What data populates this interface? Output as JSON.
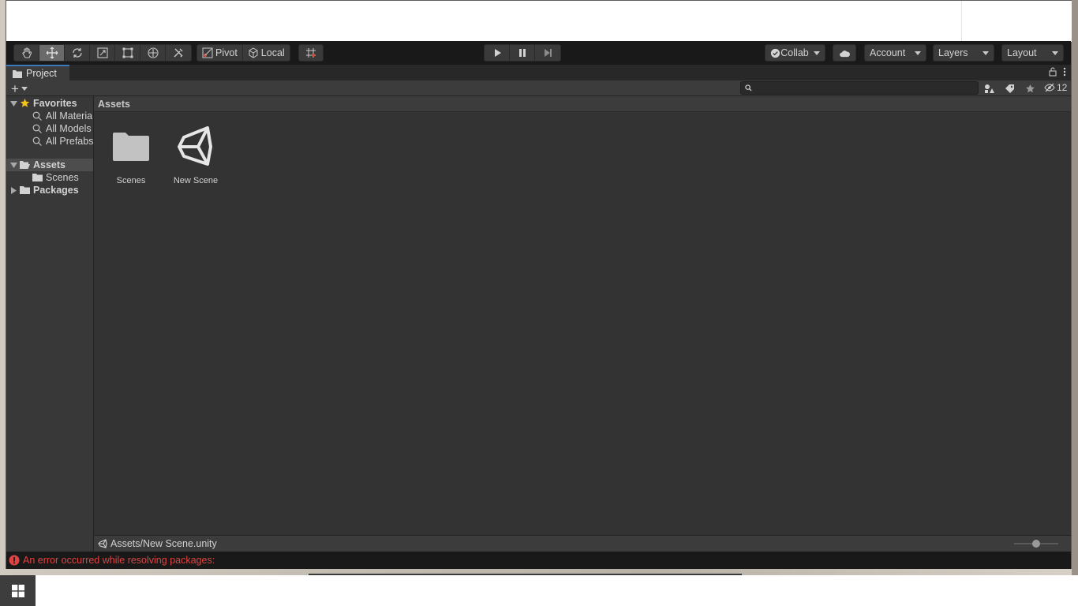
{
  "toolbar": {
    "tools": [
      "hand-tool",
      "move-tool",
      "rotate-tool",
      "scale-tool",
      "rect-tool",
      "transform-tool",
      "custom-tool"
    ],
    "pivot_label": "Pivot",
    "local_label": "Local",
    "collab_label": "Collab",
    "account_label": "Account",
    "layers_label": "Layers",
    "layout_label": "Layout"
  },
  "project": {
    "tab_label": "Project",
    "search_placeholder": "",
    "hidden_count": "12"
  },
  "tree": {
    "favorites_label": "Favorites",
    "favorites": [
      "All Materia",
      "All Models",
      "All Prefabs"
    ],
    "assets_label": "Assets",
    "assets_children": [
      "Scenes"
    ],
    "packages_label": "Packages"
  },
  "main": {
    "breadcrumb": "Assets",
    "items": [
      {
        "label": "Scenes",
        "icon": "folder-icon"
      },
      {
        "label": "New Scene",
        "icon": "unity-scene-icon"
      }
    ]
  },
  "pathbar": {
    "path": "Assets/New Scene.unity",
    "zoom_fraction": 0.5
  },
  "status": {
    "error_text": "An error occurred while resolving packages:",
    "error_color": "#e04343"
  },
  "colors": {
    "accent": "#3a79bb",
    "panel": "#383838",
    "main": "#333333"
  }
}
